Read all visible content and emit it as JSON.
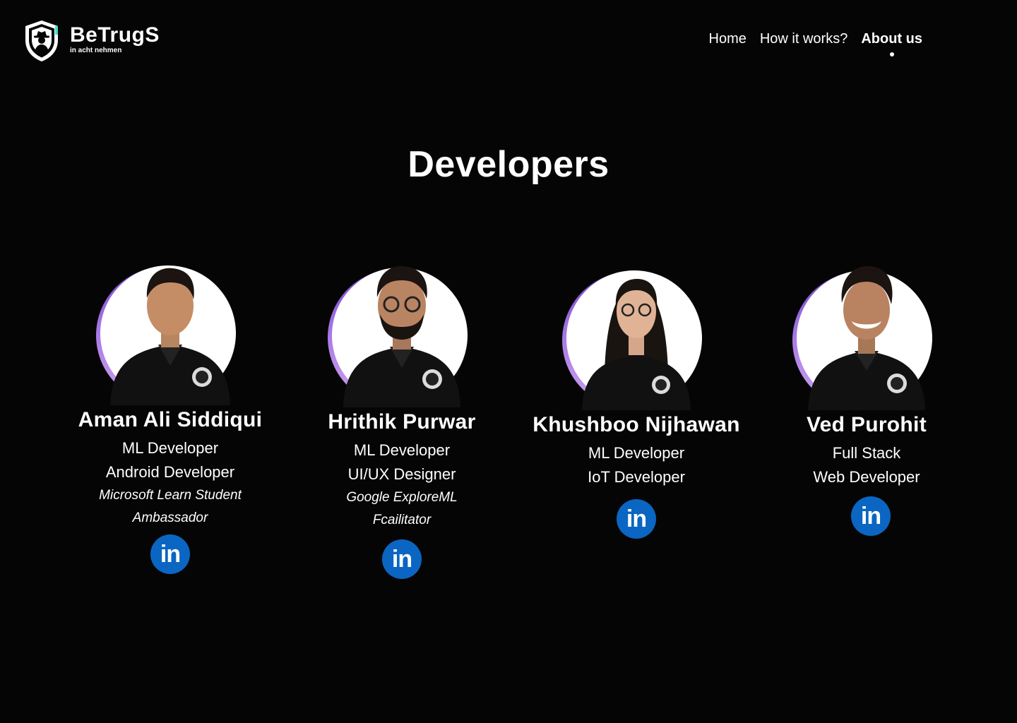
{
  "brand": {
    "name": "BeTrugS",
    "tagline": "in acht nehmen",
    "logo_icon": "shield-spy-icon"
  },
  "nav": {
    "items": [
      {
        "label": "Home",
        "active": false
      },
      {
        "label": "How it works?",
        "active": false
      },
      {
        "label": "About us",
        "active": true
      }
    ]
  },
  "section": {
    "title": "Developers"
  },
  "developers": [
    {
      "name": "Aman Ali Siddiqui",
      "roles": [
        "ML Developer",
        "Android Developer"
      ],
      "extra": [
        "Microsoft Learn Student",
        "Ambassador"
      ],
      "social_icon": "linkedin-icon",
      "social_label": "in"
    },
    {
      "name": "Hrithik Purwar",
      "roles": [
        "ML Developer",
        "UI/UX Designer"
      ],
      "extra": [
        "Google ExploreML",
        "Fcailitator"
      ],
      "social_icon": "linkedin-icon",
      "social_label": "in"
    },
    {
      "name": "Khushboo Nijhawan",
      "roles": [
        "ML Developer",
        "IoT Developer"
      ],
      "extra": [],
      "social_icon": "linkedin-icon",
      "social_label": "in"
    },
    {
      "name": "Ved Purohit",
      "roles": [
        "Full Stack",
        "Web Developer"
      ],
      "extra": [],
      "social_icon": "linkedin-icon",
      "social_label": "in"
    }
  ],
  "colors": {
    "background": "#050505",
    "text": "#ffffff",
    "accent_ring": "#9b6be0",
    "linkedin": "#0a66c2"
  }
}
